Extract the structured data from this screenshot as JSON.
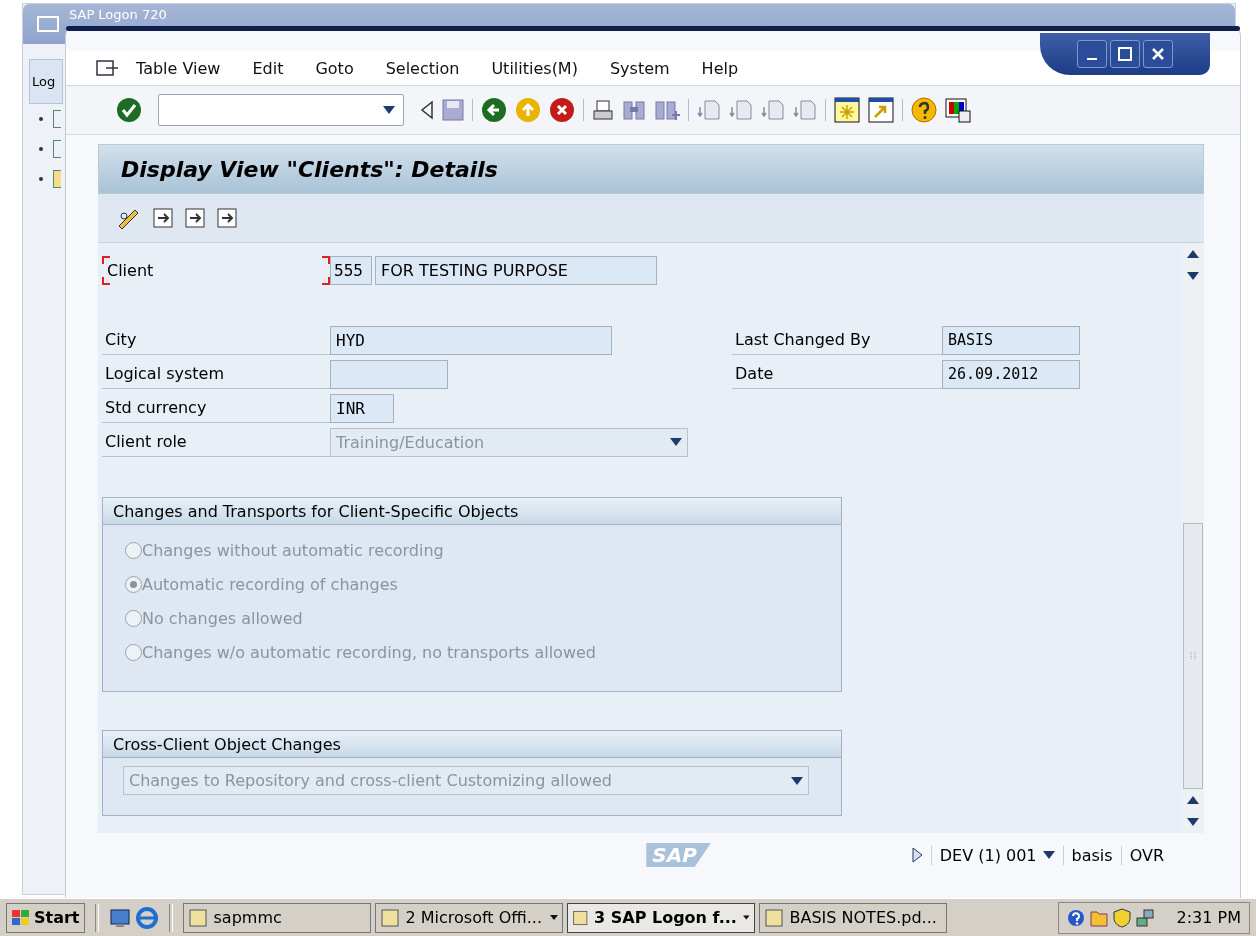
{
  "background_window": {
    "title": "SAP Logon 720",
    "tab": "Log",
    "items": [
      {
        "selected": false
      },
      {
        "selected": false
      },
      {
        "selected": true
      }
    ]
  },
  "window": {
    "menu": [
      "Table View",
      "Edit",
      "Goto",
      "Selection",
      "Utilities(M)",
      "System",
      "Help"
    ],
    "title": "Display View \"Clients\": Details",
    "client": {
      "label": "Client",
      "number": "555",
      "name": "FOR TESTING PURPOSE"
    },
    "left_fields": [
      {
        "label": "City",
        "value": "HYD",
        "kind": "text",
        "disabled": false
      },
      {
        "label": "Logical system",
        "kind": "text",
        "disabled": false
      },
      {
        "label": "Std currency",
        "value": "INR",
        "kind": "text",
        "disabled": false
      },
      {
        "label": "Client role",
        "value": "Training/Education",
        "kind": "dropdown",
        "disabled": true
      }
    ],
    "right_fields": [
      {
        "label": "Last Changed By",
        "value": "BASIS"
      },
      {
        "label": "Date",
        "value": "26.09.2012"
      }
    ],
    "transport_group": {
      "title": "Changes and Transports for Client-Specific Objects",
      "options": [
        {
          "label": "Changes without automatic recording",
          "selected": false,
          "disabled": true
        },
        {
          "label": "Automatic recording of changes",
          "selected": true,
          "disabled": true
        },
        {
          "label": "No changes allowed",
          "selected": false,
          "disabled": true
        },
        {
          "label": "Changes w/o automatic recording, no transports allowed",
          "selected": false,
          "disabled": true
        }
      ]
    },
    "cross_client_group": {
      "title": "Cross-Client Object Changes",
      "value": "Changes to Repository and cross-client Customizing allowed",
      "disabled": true
    },
    "status_bar": {
      "logo": "SAP",
      "system": "DEV (1) 001",
      "user": "basis",
      "mode": "OVR"
    }
  },
  "taskbar": {
    "start": "Start",
    "tasks": [
      {
        "label": "sapmmc",
        "selected": false,
        "has_menu": false
      },
      {
        "label": "2 Microsoft Offi...",
        "selected": false,
        "has_menu": true
      },
      {
        "label": "3 SAP Logon f...",
        "selected": true,
        "has_menu": true
      },
      {
        "label": "BASIS NOTES.pd...",
        "selected": false,
        "has_menu": false
      }
    ],
    "clock": "2:31 PM"
  }
}
